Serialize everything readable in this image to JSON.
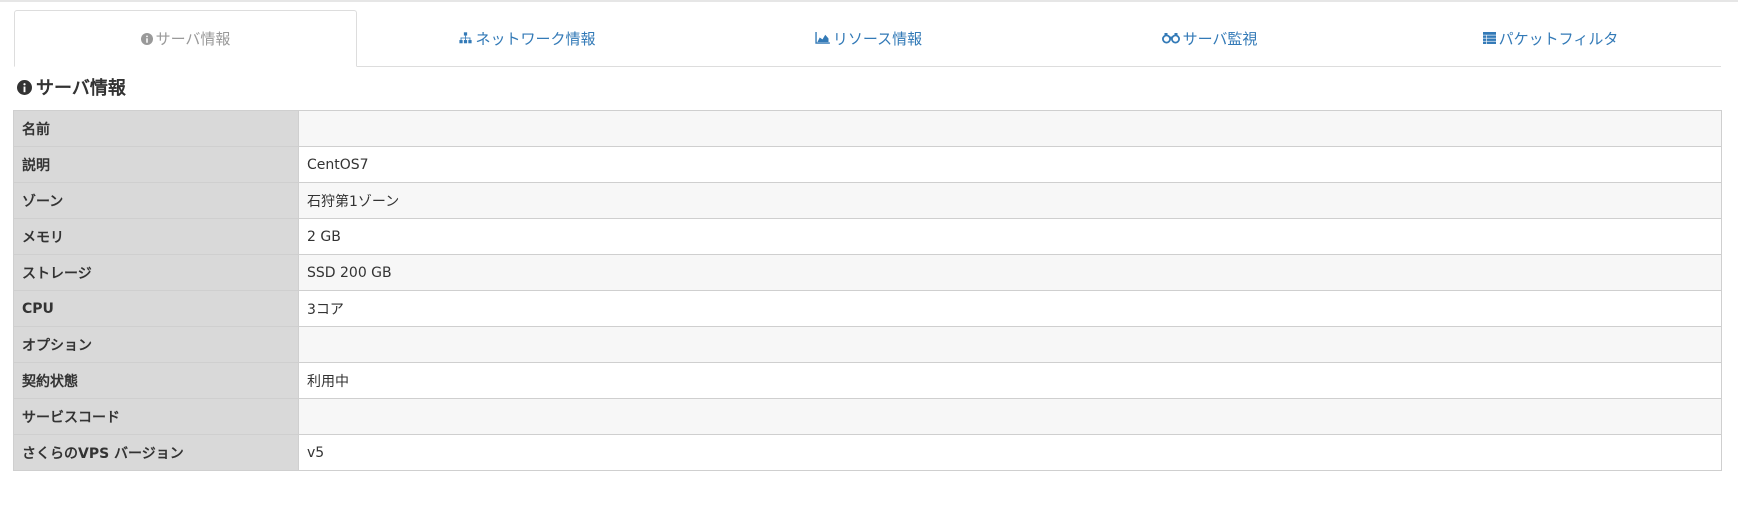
{
  "tabs": [
    {
      "label": "サーバ情報",
      "icon": "info-circle-icon",
      "active": true
    },
    {
      "label": "ネットワーク情報",
      "icon": "sitemap-icon",
      "active": false
    },
    {
      "label": "リソース情報",
      "icon": "area-chart-icon",
      "active": false
    },
    {
      "label": "サーバ監視",
      "icon": "binoculars-icon",
      "active": false
    },
    {
      "label": "パケットフィルタ",
      "icon": "table-list-icon",
      "active": false
    }
  ],
  "section": {
    "title": "サーバ情報",
    "icon": "info-circle-icon"
  },
  "server_info": {
    "rows": [
      {
        "label": "名前",
        "value": ""
      },
      {
        "label": "説明",
        "value": "CentOS7"
      },
      {
        "label": "ゾーン",
        "value": "石狩第1ゾーン"
      },
      {
        "label": "メモリ",
        "value": "2 GB"
      },
      {
        "label": "ストレージ",
        "value": "SSD 200 GB"
      },
      {
        "label": "CPU",
        "value": "3コア"
      },
      {
        "label": "オプション",
        "value": ""
      },
      {
        "label": "契約状態",
        "value": "利用中"
      },
      {
        "label": "サービスコード",
        "value": ""
      },
      {
        "label": "さくらのVPS バージョン",
        "value": "v5"
      }
    ]
  },
  "colors": {
    "link": "#337ab7",
    "active_tab": "#999999",
    "label_bg": "#d9d9d9"
  }
}
